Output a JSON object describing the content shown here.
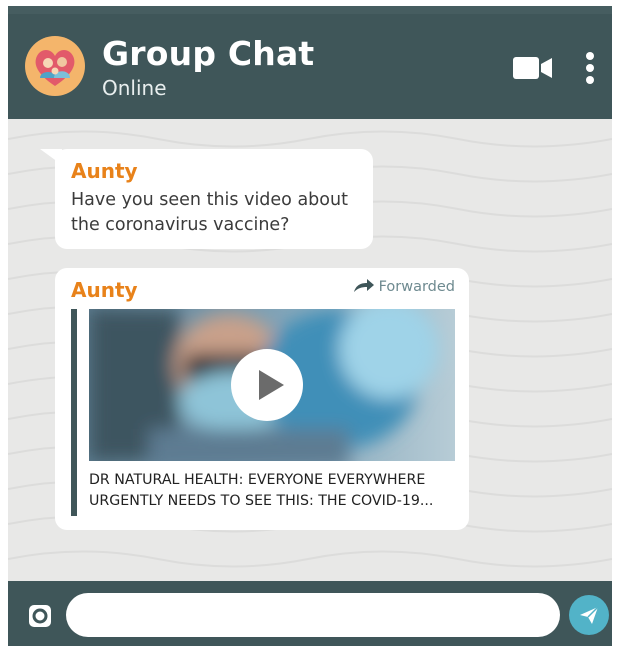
{
  "header": {
    "title": "Group Chat",
    "status": "Online",
    "avatar_icon": "family-heart-icon",
    "video_icon": "video-camera-icon",
    "menu_icon": "more-vertical-icon"
  },
  "messages": [
    {
      "sender": "Aunty",
      "text": "Have you seen this video about the coronavirus vaccine?"
    },
    {
      "sender": "Aunty",
      "forwarded_label": "Forwarded",
      "forwarded_icon": "forward-arrow-icon",
      "video_icon": "play-icon",
      "caption": "DR NATURAL HEALTH: EVERYONE EVERYWHERE URGENTLY NEEDS TO SEE THIS: THE COVID-19..."
    }
  ],
  "composer": {
    "camera_icon": "camera-icon",
    "input_value": "",
    "send_icon": "send-icon"
  },
  "colors": {
    "header_bg": "#3f5659",
    "sender_name": "#e8821a",
    "send_button": "#52b3c8",
    "chat_bg": "#e8e8e7"
  }
}
